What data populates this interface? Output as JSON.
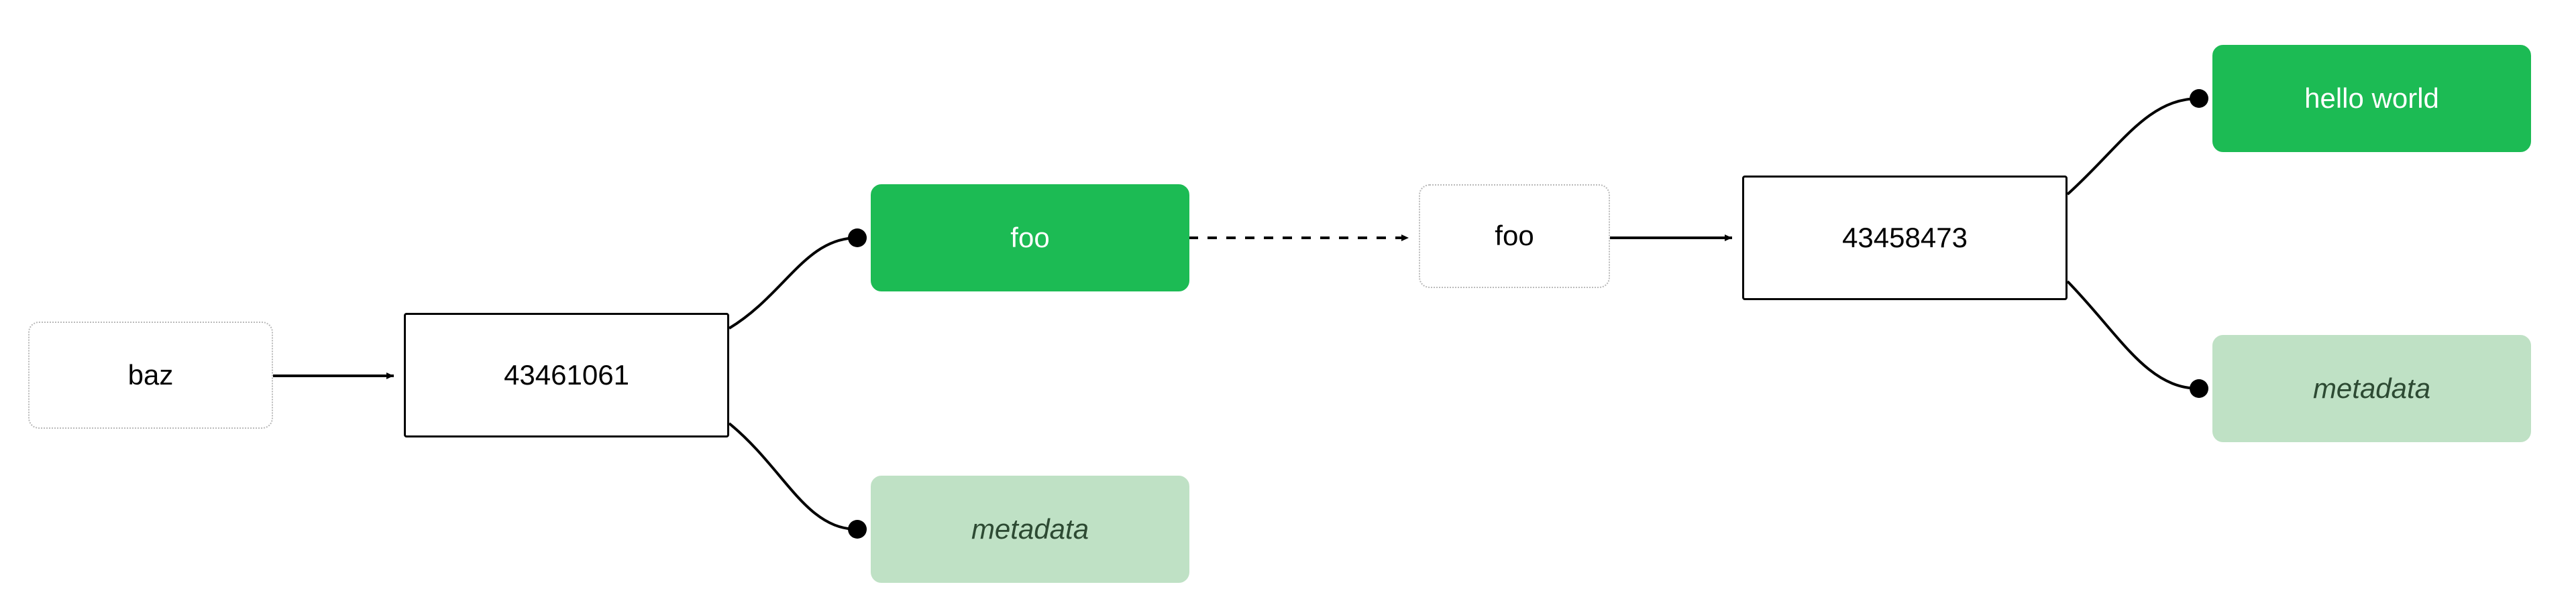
{
  "nodes": {
    "baz": {
      "label": "baz"
    },
    "num_left": {
      "label": "43461061"
    },
    "foo_green": {
      "label": "foo"
    },
    "metadata_left": {
      "label": "metadata"
    },
    "foo_dotted": {
      "label": "foo"
    },
    "num_right": {
      "label": "43458473"
    },
    "hello_world": {
      "label": "hello world"
    },
    "metadata_right": {
      "label": "metadata"
    }
  },
  "colors": {
    "green_solid": "#1cbb54",
    "green_light": "#bfe1c5",
    "black": "#000000",
    "gray_dot": "#b9b9b9"
  }
}
